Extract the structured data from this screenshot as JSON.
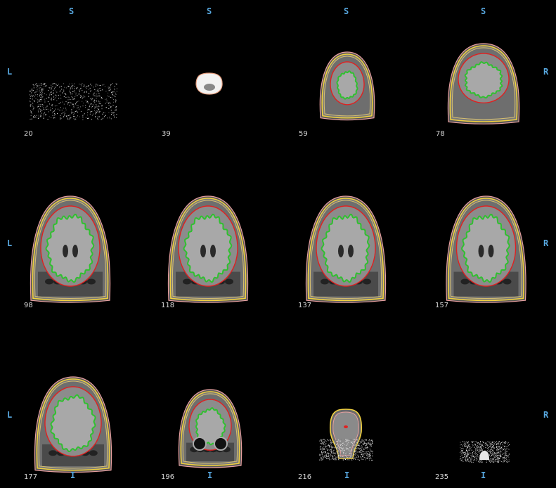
{
  "viewer": {
    "colors": {
      "background": "#000000",
      "orientation_label": "#58a8e0",
      "slice_number": "#d8d8d8",
      "contour_outer_1": "#f0d040",
      "contour_outer_2": "#e8a0a0",
      "contour_pial": "#e02020",
      "contour_white": "#30c030"
    },
    "orientation": {
      "superior": "S",
      "inferior": "I",
      "left": "L",
      "right": "R"
    },
    "slices": [
      {
        "number": "20",
        "kind": "noise"
      },
      {
        "number": "39",
        "kind": "blob"
      },
      {
        "number": "59",
        "kind": "small-brain"
      },
      {
        "number": "78",
        "kind": "brain"
      },
      {
        "number": "98",
        "kind": "brain-wide"
      },
      {
        "number": "118",
        "kind": "brain-wide"
      },
      {
        "number": "137",
        "kind": "brain-wide"
      },
      {
        "number": "157",
        "kind": "brain-wide"
      },
      {
        "number": "177",
        "kind": "brain-lower"
      },
      {
        "number": "196",
        "kind": "brain-small-lower"
      },
      {
        "number": "216",
        "kind": "brainstem"
      },
      {
        "number": "235",
        "kind": "tiny"
      }
    ]
  }
}
